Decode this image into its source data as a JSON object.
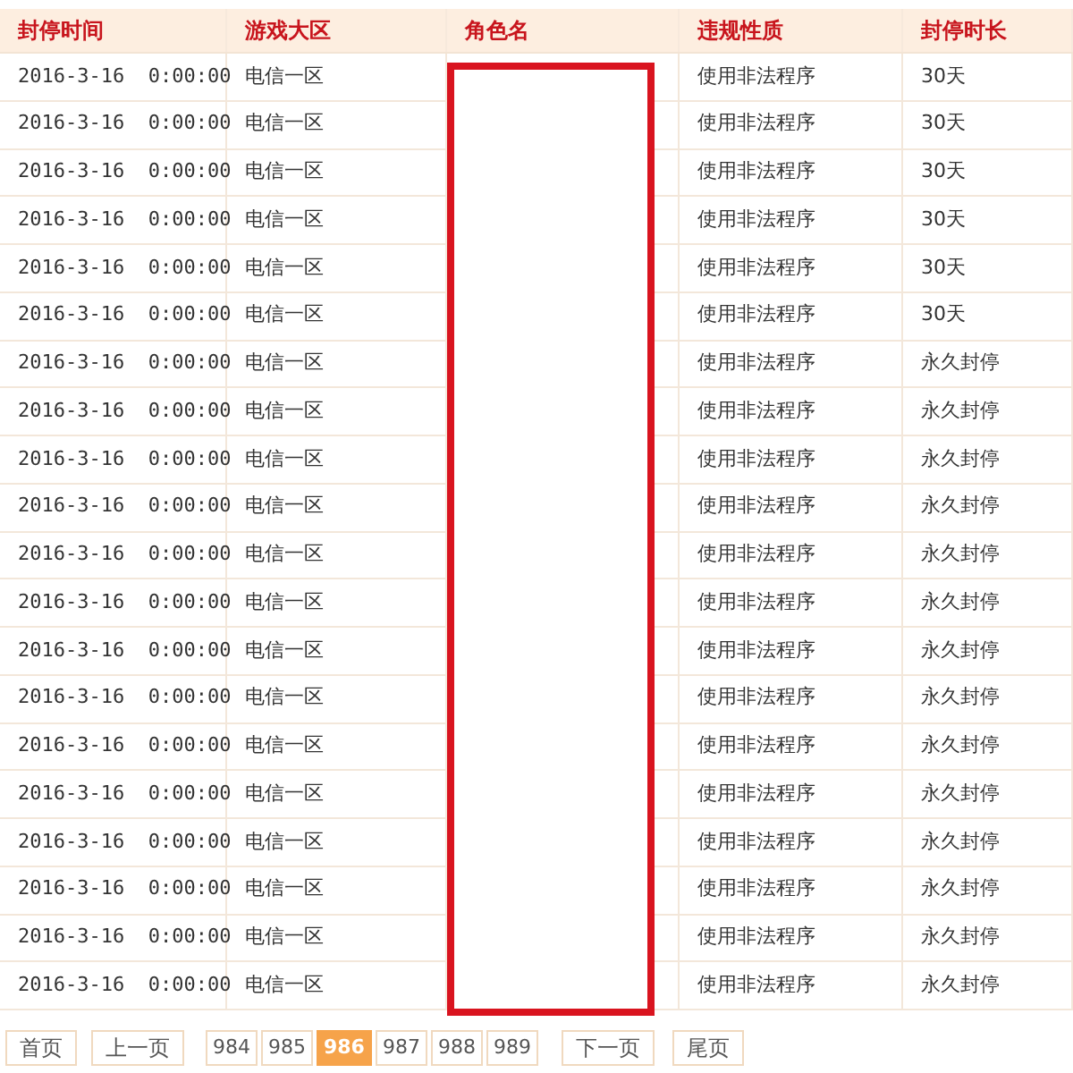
{
  "table": {
    "columns": [
      "封停时间",
      "游戏大区",
      "角色名",
      "违规性质",
      "封停时长"
    ],
    "rows": [
      {
        "time": "2016-3-16  0:00:00",
        "region": "电信一区",
        "violation": "使用非法程序",
        "duration": "30天"
      },
      {
        "time": "2016-3-16  0:00:00",
        "region": "电信一区",
        "violation": "使用非法程序",
        "duration": "30天"
      },
      {
        "time": "2016-3-16  0:00:00",
        "region": "电信一区",
        "violation": "使用非法程序",
        "duration": "30天"
      },
      {
        "time": "2016-3-16  0:00:00",
        "region": "电信一区",
        "violation": "使用非法程序",
        "duration": "30天"
      },
      {
        "time": "2016-3-16  0:00:00",
        "region": "电信一区",
        "violation": "使用非法程序",
        "duration": "30天"
      },
      {
        "time": "2016-3-16  0:00:00",
        "region": "电信一区",
        "violation": "使用非法程序",
        "duration": "30天"
      },
      {
        "time": "2016-3-16  0:00:00",
        "region": "电信一区",
        "violation": "使用非法程序",
        "duration": "永久封停"
      },
      {
        "time": "2016-3-16  0:00:00",
        "region": "电信一区",
        "violation": "使用非法程序",
        "duration": "永久封停"
      },
      {
        "time": "2016-3-16  0:00:00",
        "region": "电信一区",
        "violation": "使用非法程序",
        "duration": "永久封停"
      },
      {
        "time": "2016-3-16  0:00:00",
        "region": "电信一区",
        "violation": "使用非法程序",
        "duration": "永久封停"
      },
      {
        "time": "2016-3-16  0:00:00",
        "region": "电信一区",
        "violation": "使用非法程序",
        "duration": "永久封停"
      },
      {
        "time": "2016-3-16  0:00:00",
        "region": "电信一区",
        "violation": "使用非法程序",
        "duration": "永久封停"
      },
      {
        "time": "2016-3-16  0:00:00",
        "region": "电信一区",
        "violation": "使用非法程序",
        "duration": "永久封停"
      },
      {
        "time": "2016-3-16  0:00:00",
        "region": "电信一区",
        "violation": "使用非法程序",
        "duration": "永久封停"
      },
      {
        "time": "2016-3-16  0:00:00",
        "region": "电信一区",
        "violation": "使用非法程序",
        "duration": "永久封停"
      },
      {
        "time": "2016-3-16  0:00:00",
        "region": "电信一区",
        "violation": "使用非法程序",
        "duration": "永久封停"
      },
      {
        "time": "2016-3-16  0:00:00",
        "region": "电信一区",
        "violation": "使用非法程序",
        "duration": "永久封停"
      },
      {
        "time": "2016-3-16  0:00:00",
        "region": "电信一区",
        "violation": "使用非法程序",
        "duration": "永久封停"
      },
      {
        "time": "2016-3-16  0:00:00",
        "region": "电信一区",
        "violation": "使用非法程序",
        "duration": "永久封停"
      },
      {
        "time": "2016-3-16  0:00:00",
        "region": "电信一区",
        "violation": "使用非法程序",
        "duration": "永久封停"
      }
    ]
  },
  "pagination": {
    "first": "首页",
    "prev": "上一页",
    "pages": [
      {
        "label": "984",
        "selected": false
      },
      {
        "label": "985",
        "selected": false
      },
      {
        "label": "986",
        "selected": true
      },
      {
        "label": "987",
        "selected": false
      },
      {
        "label": "988",
        "selected": false
      },
      {
        "label": "989",
        "selected": false
      }
    ],
    "next": "下一页",
    "last": "尾页"
  }
}
